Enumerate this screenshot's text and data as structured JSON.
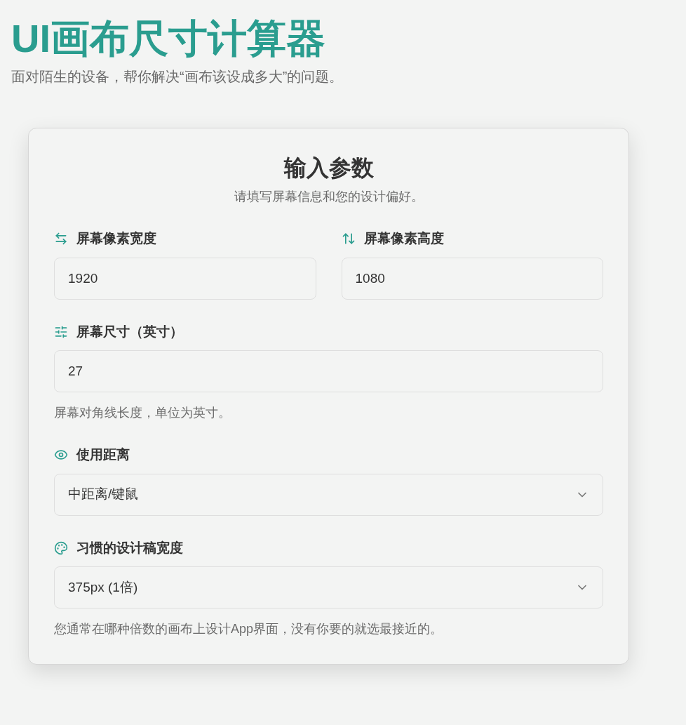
{
  "header": {
    "title": "UI画布尺寸计算器",
    "subtitle": "面对陌生的设备，帮你解决“画布该设成多大”的问题。"
  },
  "card": {
    "title": "输入参数",
    "subtitle": "请填写屏幕信息和您的设计偏好。",
    "rows": [
      [
        {
          "kind": "input",
          "label": "屏幕像素宽度",
          "value": "1920"
        },
        {
          "kind": "input",
          "label": "屏幕像素高度",
          "value": "1080"
        }
      ],
      [
        {
          "kind": "input",
          "label": "屏幕尺寸（英寸）",
          "value": "27",
          "hint": "屏幕对角线长度，单位为英寸。"
        }
      ],
      [
        {
          "kind": "select",
          "label": "使用距离",
          "value": "中距离/键鼠"
        }
      ],
      [
        {
          "kind": "select",
          "label": "习惯的设计稿宽度",
          "value": "375px (1倍)",
          "hint": "您通常在哪种倍数的画布上设计App界面，没有你要的就选最接近的。"
        }
      ]
    ]
  }
}
